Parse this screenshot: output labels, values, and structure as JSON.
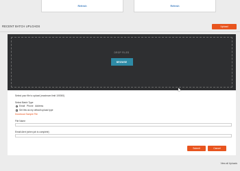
{
  "top_buttons": [
    "Refresh",
    "Refresh"
  ],
  "recent": {
    "title": "RECENT BATCH UPLOADS",
    "action_label": "Upload",
    "view_all": "View all Uploads"
  },
  "dropzone": {
    "label": "DROP FILES",
    "browse_label": "BROWSE"
  },
  "form": {
    "instruction": "Select your file to upload (maximum limit 100000)",
    "batch_type_label": "Select Batch Type",
    "batch_type_option": "Email   Phone   Address",
    "default_checkbox_label": "Set this as my default upload type",
    "sample_link": "Download Sample File",
    "file_name_label": "File Name",
    "email_alert_label": "Email Alert (when job is complete)",
    "submit_label": "Submit",
    "cancel_label": "Cancel"
  },
  "colors": {
    "accent": "#e8541e",
    "dropzone_bg": "#2e2f31",
    "browse": "#2e8ba6",
    "link": "#3a7bbf"
  }
}
